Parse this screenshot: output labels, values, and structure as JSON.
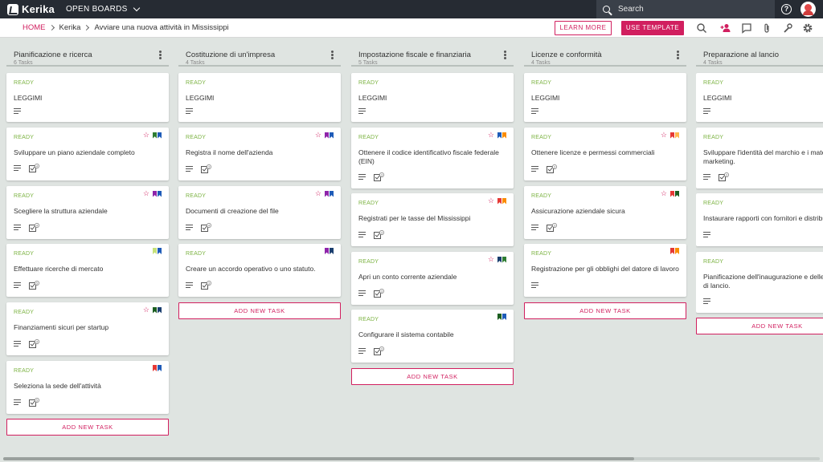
{
  "topbar": {
    "logo": "Kerika",
    "open_boards": "OPEN BOARDS",
    "search_placeholder": "Search"
  },
  "subbar": {
    "breadcrumb": [
      "HOME",
      "Kerika",
      "Avviare una nuova attività in Mississippi"
    ],
    "learn_more": "LEARN MORE",
    "use_template": "USE TEMPLATE"
  },
  "colors": {
    "accent": "#d11f5f",
    "ready": "#7cb342",
    "tag_green": "#2e7d32",
    "tag_blue": "#1e5bb8",
    "tag_purple": "#8e24aa",
    "tag_red": "#e53935",
    "tag_orange": "#fb8c00",
    "tag_lightgreen": "#c5e17a",
    "tag_navy": "#1a3e6e",
    "tag_darkgreen": "#1b5e20",
    "tag_lightorange": "#ffb74d"
  },
  "columns": [
    {
      "title": "Pianificazione e ricerca",
      "count": "6 Tasks",
      "add_label": "ADD NEW TASK",
      "cards": [
        {
          "status": "READY",
          "title": "LEGGIMI",
          "checklist": null
        },
        {
          "status": "READY",
          "title": "Sviluppare un piano aziendale completo",
          "checklist": "4"
        },
        {
          "status": "READY",
          "title": "Scegliere la struttura aziendale",
          "checklist": "4"
        },
        {
          "status": "READY",
          "title": "Effettuare ricerche di mercato",
          "checklist": "5"
        },
        {
          "status": "READY",
          "title": "Finanziamenti sicuri per startup",
          "checklist": "4"
        },
        {
          "status": "READY",
          "title": "Seleziona la sede dell'attività",
          "checklist": "5"
        }
      ]
    },
    {
      "title": "Costituzione di un'impresa",
      "count": "4 Tasks",
      "add_label": "ADD NEW TASK",
      "cards": [
        {
          "status": "READY",
          "title": "LEGGIMI",
          "checklist": null
        },
        {
          "status": "READY",
          "title": "Registra il nome dell'azienda",
          "checklist": "3"
        },
        {
          "status": "READY",
          "title": "Documenti di creazione del file",
          "checklist": "4"
        },
        {
          "status": "READY",
          "title": "Creare un accordo operativo o uno statuto.",
          "checklist": "3"
        }
      ]
    },
    {
      "title": "Impostazione fiscale e finanziaria",
      "count": "5 Tasks",
      "add_label": "ADD NEW TASK",
      "cards": [
        {
          "status": "READY",
          "title": "LEGGIMI",
          "checklist": null
        },
        {
          "status": "READY",
          "title": "Ottenere il codice identificativo fiscale federale (EIN)",
          "checklist": "3"
        },
        {
          "status": "READY",
          "title": "Registrati per le tasse del Mississippi",
          "checklist": "3"
        },
        {
          "status": "READY",
          "title": "Apri un conto corrente aziendale",
          "checklist": "3"
        },
        {
          "status": "READY",
          "title": "Configurare il sistema contabile",
          "checklist": "3"
        }
      ]
    },
    {
      "title": "Licenze e conformità",
      "count": "4 Tasks",
      "add_label": "ADD NEW TASK",
      "cards": [
        {
          "status": "READY",
          "title": "LEGGIMI",
          "checklist": null
        },
        {
          "status": "READY",
          "title": "Ottenere licenze e permessi commerciali",
          "checklist": "3"
        },
        {
          "status": "READY",
          "title": "Assicurazione aziendale sicura",
          "checklist": "3"
        },
        {
          "status": "READY",
          "title": "Registrazione per gli obblighi del datore di lavoro",
          "checklist": null
        }
      ]
    },
    {
      "title": "Preparazione al lancio",
      "count": "4 Tasks",
      "add_label": "ADD NEW TASK",
      "cards": [
        {
          "status": "READY",
          "title": "LEGGIMI",
          "checklist": null
        },
        {
          "status": "READY",
          "title": "Sviluppare l'identità del marchio e i materiali di marketing.",
          "checklist": "3"
        },
        {
          "status": "READY",
          "title": "Instaurare rapporti con fornitori e distributori",
          "checklist": null
        },
        {
          "status": "READY",
          "title": "Pianificazione dell'inaugurazione e delle attività di lancio.",
          "checklist": null
        }
      ]
    }
  ]
}
